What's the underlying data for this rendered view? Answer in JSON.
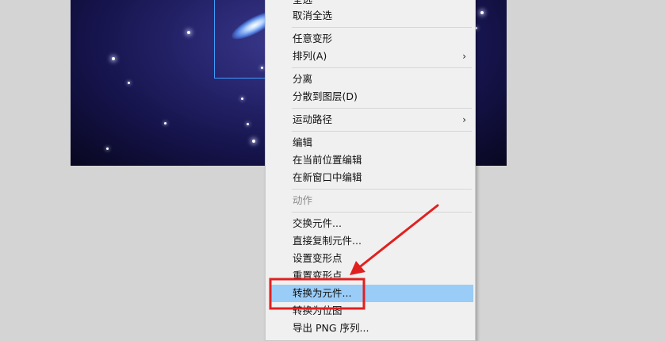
{
  "context_menu": {
    "items": [
      {
        "label": "全选"
      },
      {
        "label": "取消全选"
      },
      {
        "label": "任意变形"
      },
      {
        "label": "排列(A)",
        "submenu": true
      },
      {
        "label": "分离"
      },
      {
        "label": "分散到图层(D)"
      },
      {
        "label": "运动路径",
        "submenu": true
      },
      {
        "label": "编辑"
      },
      {
        "label": "在当前位置编辑"
      },
      {
        "label": "在新窗口中编辑"
      },
      {
        "label": "动作",
        "disabled": true
      },
      {
        "label": "交换元件..."
      },
      {
        "label": "直接复制元件..."
      },
      {
        "label": "设置变形点"
      },
      {
        "label": "重置变形点"
      },
      {
        "label": "转换为元件...",
        "highlighted": true
      },
      {
        "label": "转换为位图"
      },
      {
        "label": "导出 PNG 序列..."
      }
    ],
    "submenu_glyph": "›"
  },
  "colors": {
    "highlight": "#99ccf7",
    "annotation_red": "#e02020",
    "selection_blue": "#3f9dff"
  }
}
